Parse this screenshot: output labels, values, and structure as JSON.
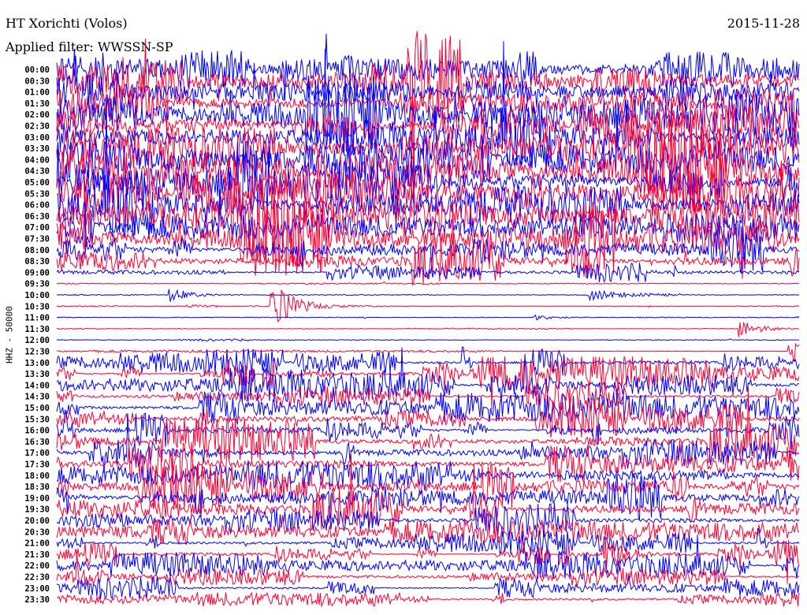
{
  "header": {
    "station": "HT Xorichti (Volos)",
    "filter": "Applied filter: WWSSN-SP",
    "date": "2015-11-28"
  },
  "chart_data": {
    "type": "line",
    "title": "HT Xorichti (Volos)",
    "subtitle": "Applied filter: WWSSN-SP",
    "date": "2015-11-28",
    "ylabel": "HHZ - 50000",
    "row_minutes": 30,
    "colors": [
      "#0000ff",
      "#ff0033"
    ],
    "row_labels": [
      "00:00",
      "00:30",
      "01:00",
      "01:30",
      "02:00",
      "02:30",
      "03:00",
      "03:30",
      "04:00",
      "04:30",
      "05:00",
      "05:30",
      "06:00",
      "06:30",
      "07:00",
      "07:30",
      "08:00",
      "08:30",
      "09:00",
      "09:30",
      "10:00",
      "10:30",
      "11:00",
      "11:30",
      "12:00",
      "12:30",
      "13:00",
      "13:30",
      "14:00",
      "14:30",
      "15:00",
      "15:30",
      "16:00",
      "16:30",
      "17:00",
      "17:30",
      "18:00",
      "18:30",
      "19:00",
      "19:30",
      "20:00",
      "20:30",
      "21:00",
      "21:30",
      "22:00",
      "22:30",
      "23:00",
      "23:30"
    ],
    "noise_level": [
      1.5,
      1.5,
      1.6,
      1.5,
      1.6,
      1.5,
      1.4,
      1.7,
      1.8,
      1.8,
      1.7,
      1.8,
      1.6,
      1.7,
      1.6,
      1.5,
      1.0,
      0.9,
      0.35,
      0.06,
      0.05,
      0.05,
      0.04,
      0.05,
      0.04,
      0.06,
      0.55,
      0.6,
      0.55,
      0.5,
      0.7,
      0.75,
      0.7,
      0.8,
      0.7,
      0.8,
      0.85,
      0.9,
      0.95,
      0.8,
      0.6,
      0.55,
      0.5,
      0.5,
      0.45,
      0.45,
      0.4,
      0.4
    ],
    "burstiness": [
      0.1,
      0.1,
      0.1,
      0.1,
      0.1,
      0.1,
      0.1,
      0.15,
      0.15,
      0.15,
      0.15,
      0.15,
      0.2,
      0.2,
      0.2,
      0.25,
      0.5,
      0.5,
      0.6,
      0.2,
      0.2,
      0.2,
      0.2,
      0.2,
      0.2,
      0.6,
      0.8,
      0.8,
      0.8,
      0.8,
      0.7,
      0.7,
      0.7,
      0.6,
      0.7,
      0.6,
      0.5,
      0.5,
      0.4,
      0.5,
      0.7,
      0.7,
      0.8,
      0.8,
      0.8,
      0.8,
      0.8,
      0.8
    ],
    "events": [
      {
        "row": 20,
        "minute": 4.5,
        "amplitude": 0.7
      },
      {
        "row": 20,
        "minute": 21.5,
        "amplitude": 0.5
      },
      {
        "row": 21,
        "minute": 8.6,
        "amplitude": 2.6
      },
      {
        "row": 22,
        "minute": 19.2,
        "amplitude": 0.3
      },
      {
        "row": 23,
        "minute": 27.5,
        "amplitude": 0.9
      },
      {
        "row": 25,
        "minute": 29.5,
        "amplitude": 1.2
      },
      {
        "row": 43,
        "minute": 22.0,
        "amplitude": 2.0
      }
    ]
  }
}
